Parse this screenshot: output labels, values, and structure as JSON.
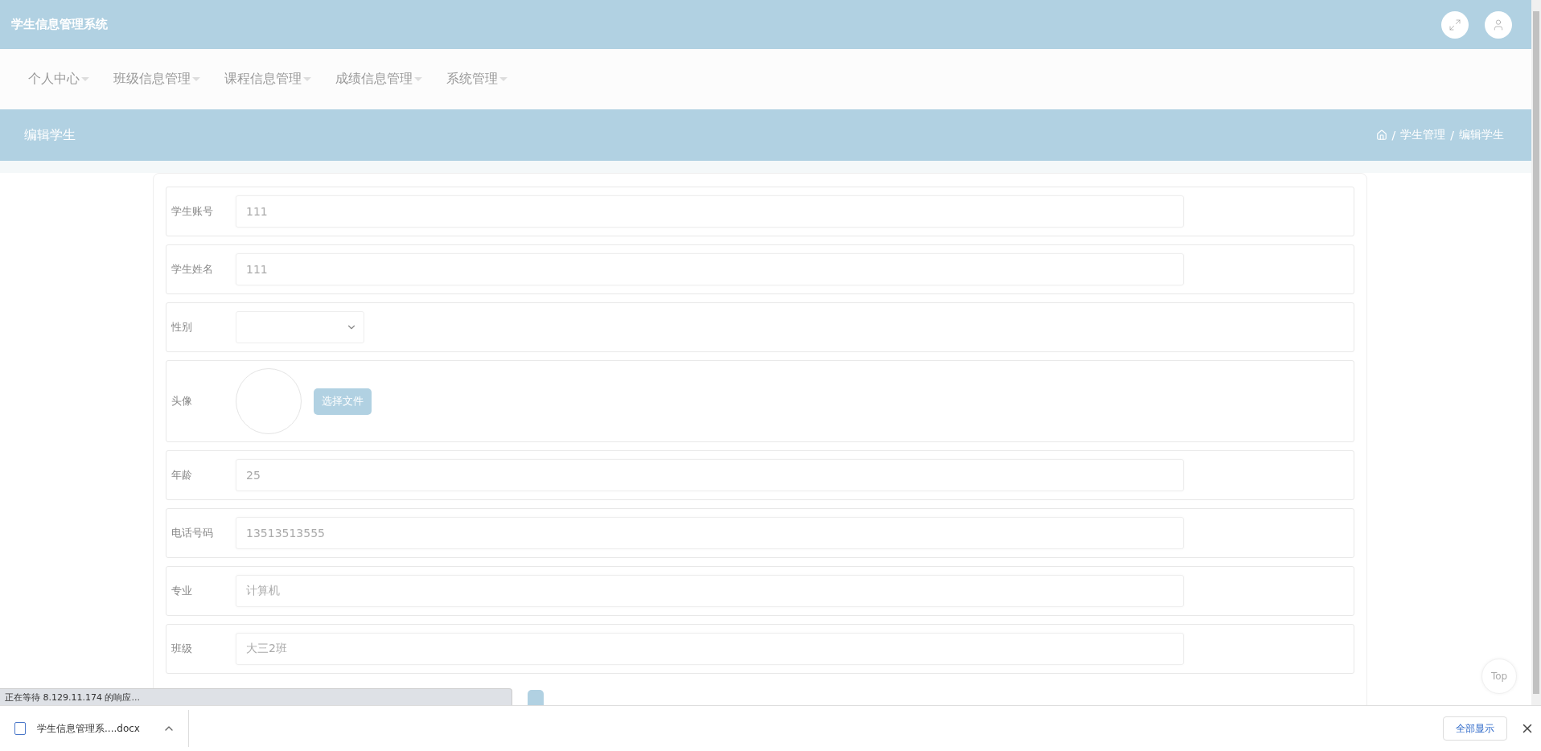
{
  "header": {
    "title": "学生信息管理系统"
  },
  "nav": [
    {
      "label": "个人中心"
    },
    {
      "label": "班级信息管理"
    },
    {
      "label": "课程信息管理"
    },
    {
      "label": "成绩信息管理"
    },
    {
      "label": "系统管理"
    }
  ],
  "page_title": "编辑学生",
  "breadcrumb": [
    {
      "separator": "/",
      "label": "学生管理"
    },
    {
      "separator": "/",
      "label": "编辑学生"
    }
  ],
  "form": {
    "fields": [
      {
        "kind": "text",
        "label": "学生账号",
        "value": "111"
      },
      {
        "kind": "text",
        "label": "学生姓名",
        "value": "111"
      },
      {
        "kind": "select",
        "label": "性别"
      },
      {
        "kind": "avatar",
        "label": "头像",
        "button": "选择文件"
      },
      {
        "kind": "text",
        "label": "年龄",
        "value": "25"
      },
      {
        "kind": "text",
        "label": "电话号码",
        "value": "13513513555"
      },
      {
        "kind": "text",
        "label": "专业",
        "value": "计算机"
      },
      {
        "kind": "text",
        "label": "班级",
        "value": "大三2班"
      }
    ]
  },
  "back_to_top": "Top",
  "browser": {
    "status": "正在等待 8.129.11.174 的响应...",
    "download": "学生信息管理系....docx",
    "show_all": "全部显示"
  }
}
